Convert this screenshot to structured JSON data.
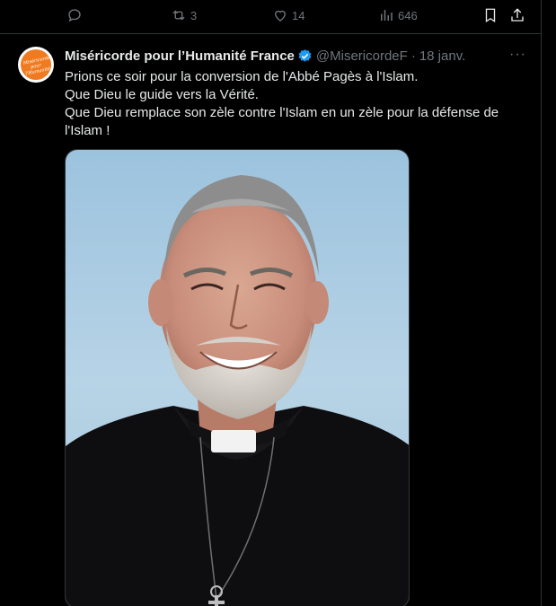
{
  "prev_tweet_actions": {
    "reply_icon": "reply-icon",
    "retweet_count": "3",
    "like_count": "14",
    "views_count": "646",
    "bookmark_icon": "bookmark-icon",
    "share_icon": "share-icon"
  },
  "tweet": {
    "author_name": "Miséricorde pour l’Humanité France",
    "handle": "@MisericordeF",
    "dot": "·",
    "date": "18 janv.",
    "more": "···",
    "lines": [
      "Prions ce soir pour la conversion de l'Abbé Pagès à l'Islam.",
      "Que Dieu le guide vers la Vérité.",
      "Que Dieu remplace son zèle contre l'Islam en un zèle pour la défense de l'Islam !"
    ],
    "avatar_logo_text": "Miséricorde pour l'Humanité",
    "media_description_icon": "photo"
  },
  "colors": {
    "background": "#000000",
    "text": "#e7e9ea",
    "muted": "#71767b",
    "border": "#2f3336",
    "verified": "#1d9bf0",
    "avatar": "#f07a1f"
  }
}
